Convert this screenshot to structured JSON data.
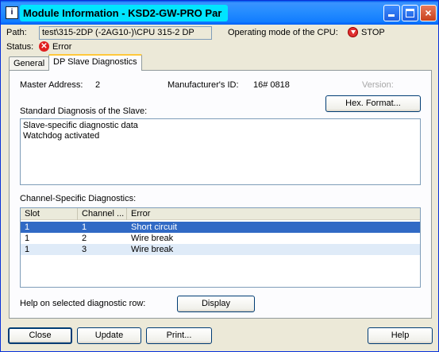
{
  "window": {
    "title": "Module Information - KSD2-GW-PRO Par",
    "icon_glyph": "i",
    "minimize_glyph": "",
    "close_glyph": "×"
  },
  "info": {
    "path_label": "Path:",
    "path_value": "test\\315-2DP (-2AG10-)\\CPU 315-2 DP",
    "mode_label": "Operating mode of the  CPU:",
    "mode_value": "STOP",
    "status_label": "Status:",
    "status_icon_glyph": "✕",
    "status_value": "Error"
  },
  "tabs": [
    {
      "label": "General",
      "active": false
    },
    {
      "label": "DP Slave Diagnostics",
      "active": true
    }
  ],
  "panel": {
    "master_address_label": "Master Address:",
    "master_address_value": "2",
    "manufacturer_id_label": "Manufacturer's ID:",
    "manufacturer_id_value": "16# 0818",
    "version_label": "Version:",
    "hex_format_button": "Hex. Format...",
    "standard_diag_label": "Standard Diagnosis of the Slave:",
    "standard_diag_lines": [
      "Slave-specific diagnostic data",
      "Watchdog activated"
    ],
    "channel_diag_label": "Channel-Specific Diagnostics:",
    "columns": [
      "Slot",
      "Channel ...",
      "Error"
    ],
    "rows": [
      {
        "slot": "1",
        "channel": "1",
        "error": "Short circuit",
        "selected": true
      },
      {
        "slot": "1",
        "channel": "2",
        "error": "Wire break",
        "selected": false
      },
      {
        "slot": "1",
        "channel": "3",
        "error": "Wire break",
        "selected": false
      }
    ],
    "help_label": "Help on selected diagnostic row:",
    "display_button": "Display"
  },
  "footer": {
    "close_button": "Close",
    "update_button": "Update",
    "print_button": "Print...",
    "help_button": "Help"
  },
  "colors": {
    "title_highlight": "#00E5FF",
    "selection": "#316AC5",
    "alt_row": "#DFEBF8",
    "stop_red": "#E03030"
  }
}
